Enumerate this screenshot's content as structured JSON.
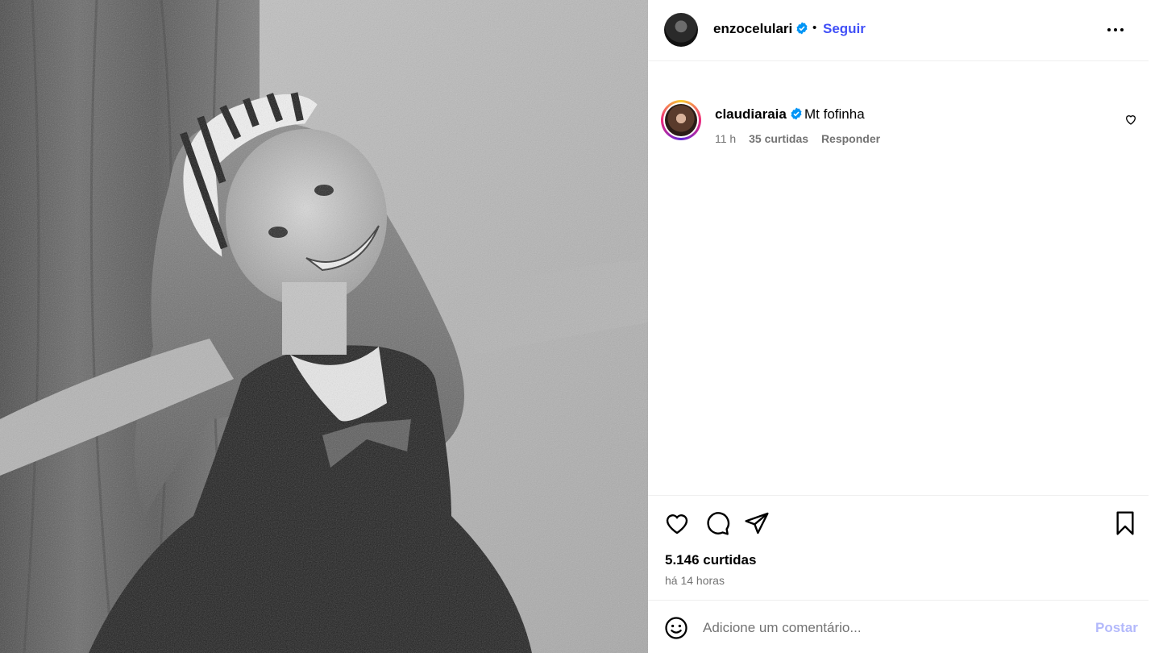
{
  "post": {
    "username": "enzocelulari",
    "follow_label": "Seguir",
    "separator": "•",
    "photo_description_icon": "photo",
    "verified_icon": "verified-badge-icon",
    "more_icon": "more-options-icon"
  },
  "comment": {
    "username": "claudiaraia",
    "text": "Mt fofinha",
    "time": "11 h",
    "likes": "35 curtidas",
    "reply_label": "Responder"
  },
  "actions": {
    "likes_count": "5.146 curtidas",
    "posted_ago": "há 14 horas"
  },
  "composer": {
    "placeholder": "Adicione um comentário...",
    "post_label": "Postar"
  },
  "colors": {
    "follow": "#4150f7",
    "post_disabled": "#b3b9fb",
    "muted_text": "#737373",
    "verified": "#0095f6",
    "divider": "#efefef"
  }
}
